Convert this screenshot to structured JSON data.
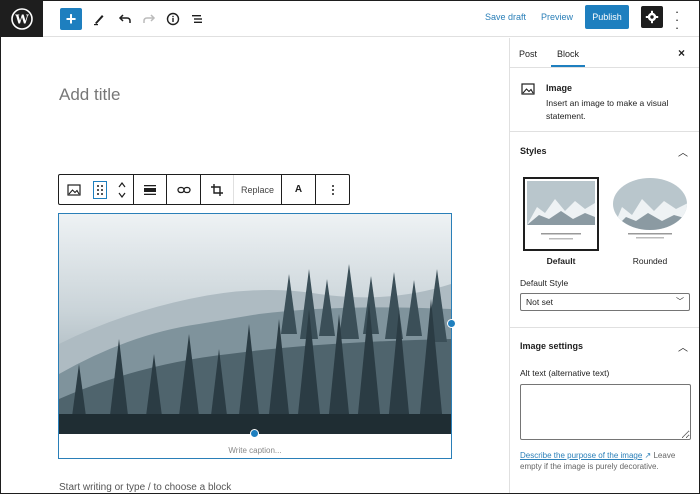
{
  "topbar": {
    "logo": "wordpress-logo",
    "add_block_label": "+",
    "save_draft_label": "Save draft",
    "preview_label": "Preview",
    "publish_label": "Publish",
    "icons": [
      "pencil-icon",
      "undo-icon",
      "redo-icon",
      "info-icon",
      "list-view-icon",
      "gear-icon",
      "kebab-icon"
    ]
  },
  "editor": {
    "title_placeholder": "Add title",
    "block_toolbar": {
      "replace_label": "Replace",
      "text_label": "A"
    },
    "image_caption_placeholder": "Write caption...",
    "body_placeholder": "Start writing or type / to choose a block"
  },
  "sidebar": {
    "tabs": [
      {
        "label": "Post",
        "active": false
      },
      {
        "label": "Block",
        "active": true
      }
    ],
    "block_card": {
      "name": "Image",
      "description": "Insert an image to make a visual statement."
    },
    "styles_panel": {
      "title": "Styles",
      "options": [
        {
          "label": "Default",
          "selected": true
        },
        {
          "label": "Rounded",
          "selected": false
        }
      ],
      "default_style_label": "Default Style",
      "default_style_value": "Not set"
    },
    "image_settings_panel": {
      "title": "Image settings",
      "alt_text_label": "Alt text (alternative text)",
      "alt_text_value": "",
      "help_link": "Describe the purpose of the image",
      "help_text": "Leave empty if the image is purely decorative."
    }
  },
  "colors": {
    "accent": "#1e7fbf",
    "dark": "#1e1e1e",
    "border": "#e0e0e0"
  }
}
